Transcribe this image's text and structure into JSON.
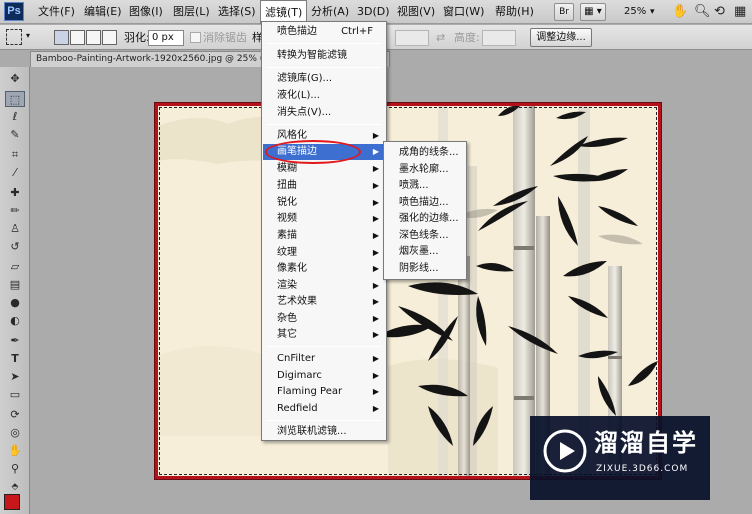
{
  "menubar": {
    "logo": "Ps",
    "items": [
      "文件(F)",
      "编辑(E)",
      "图像(I)",
      "图层(L)",
      "选择(S)",
      "滤镜(T)",
      "分析(A)",
      "3D(D)",
      "视图(V)",
      "窗口(W)",
      "帮助(H)"
    ],
    "active_index": 5,
    "br_label": "Br",
    "mb_label": "Mb",
    "zoom": "25%"
  },
  "options": {
    "feather_label": "羽化:",
    "feather_value": "0 px",
    "antialias_label": "消除锯齿",
    "style_label": "样",
    "height_label": "高度:",
    "refine_edge": "调整边缘..."
  },
  "document": {
    "tab_title": "Bamboo-Painting-Artwork-1920x2560.jpg @ 25% (背"
  },
  "filter_menu": {
    "items": [
      {
        "label": "喷色描边",
        "shortcut": "Ctrl+F"
      },
      {
        "label": "转换为智能滤镜"
      },
      {
        "label": "滤镜库(G)..."
      },
      {
        "label": "液化(L)..."
      },
      {
        "label": "消失点(V)..."
      },
      {
        "label": "风格化",
        "submenu": true
      },
      {
        "label": "画笔描边",
        "submenu": true,
        "highlight": true
      },
      {
        "label": "模糊",
        "submenu": true
      },
      {
        "label": "扭曲",
        "submenu": true
      },
      {
        "label": "锐化",
        "submenu": true
      },
      {
        "label": "视频",
        "submenu": true
      },
      {
        "label": "素描",
        "submenu": true
      },
      {
        "label": "纹理",
        "submenu": true
      },
      {
        "label": "像素化",
        "submenu": true
      },
      {
        "label": "渲染",
        "submenu": true
      },
      {
        "label": "艺术效果",
        "submenu": true
      },
      {
        "label": "杂色",
        "submenu": true
      },
      {
        "label": "其它",
        "submenu": true
      },
      {
        "label": "CnFilter",
        "submenu": true
      },
      {
        "label": "Digimarc",
        "submenu": true
      },
      {
        "label": "Flaming Pear",
        "submenu": true
      },
      {
        "label": "Redfield",
        "submenu": true
      },
      {
        "label": "浏览联机滤镜..."
      }
    ]
  },
  "brush_strokes_submenu": {
    "items": [
      "成角的线条...",
      "墨水轮廓...",
      "喷溅...",
      "喷色描边...",
      "强化的边缘...",
      "深色线条...",
      "烟灰墨...",
      "阴影线..."
    ]
  },
  "watermark": {
    "title": "溜溜自学",
    "subtitle": "ZIXUE.3D66.COM"
  }
}
